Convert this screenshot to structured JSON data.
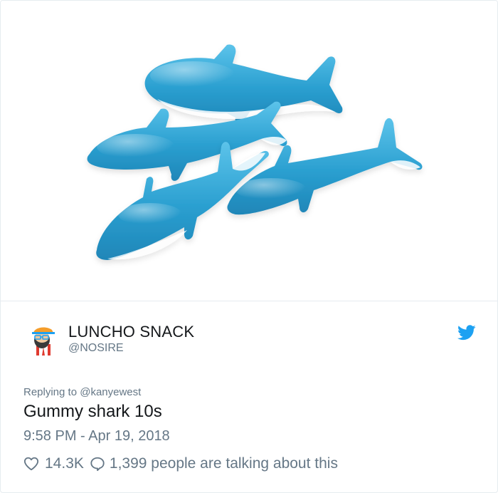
{
  "media": {
    "alt_icon": "gummy-shark-photo"
  },
  "author": {
    "display_name": "LUNCHO SNACK",
    "handle": "@NOSIRE",
    "avatar_icon": "avatar-cartoon-man"
  },
  "platform_icon": "twitter-bird-icon",
  "reply_context": "Replying to @kanyewest",
  "tweet": {
    "text": "Gummy shark 10s",
    "timestamp": "9:58 PM - Apr 19, 2018"
  },
  "actions": {
    "likes": "14.3K",
    "talking": "1,399 people are talking about this"
  },
  "colors": {
    "twitter_blue": "#1da1f2",
    "shark_blue": "#2a9fd0",
    "text_primary": "#14171a",
    "text_secondary": "#657786"
  }
}
